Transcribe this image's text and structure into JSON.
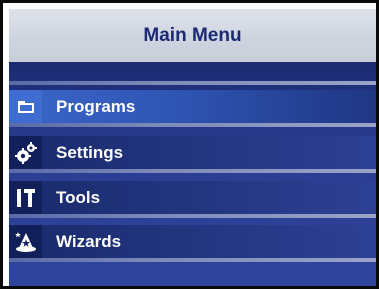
{
  "window": {
    "title": "Main Menu"
  },
  "menu": {
    "items": [
      {
        "label": "Programs",
        "icon": "folder-icon",
        "selected": true
      },
      {
        "label": "Settings",
        "icon": "gears-icon",
        "selected": false
      },
      {
        "label": "Tools",
        "icon": "hammer-icon",
        "selected": false
      },
      {
        "label": "Wizards",
        "icon": "wizard-hat-icon",
        "selected": false
      }
    ]
  },
  "colors": {
    "title_text": "#1b2a72",
    "menu_background": "#2b3d92",
    "selected_item": "#3a66c8",
    "item_text": "#ffffff"
  }
}
